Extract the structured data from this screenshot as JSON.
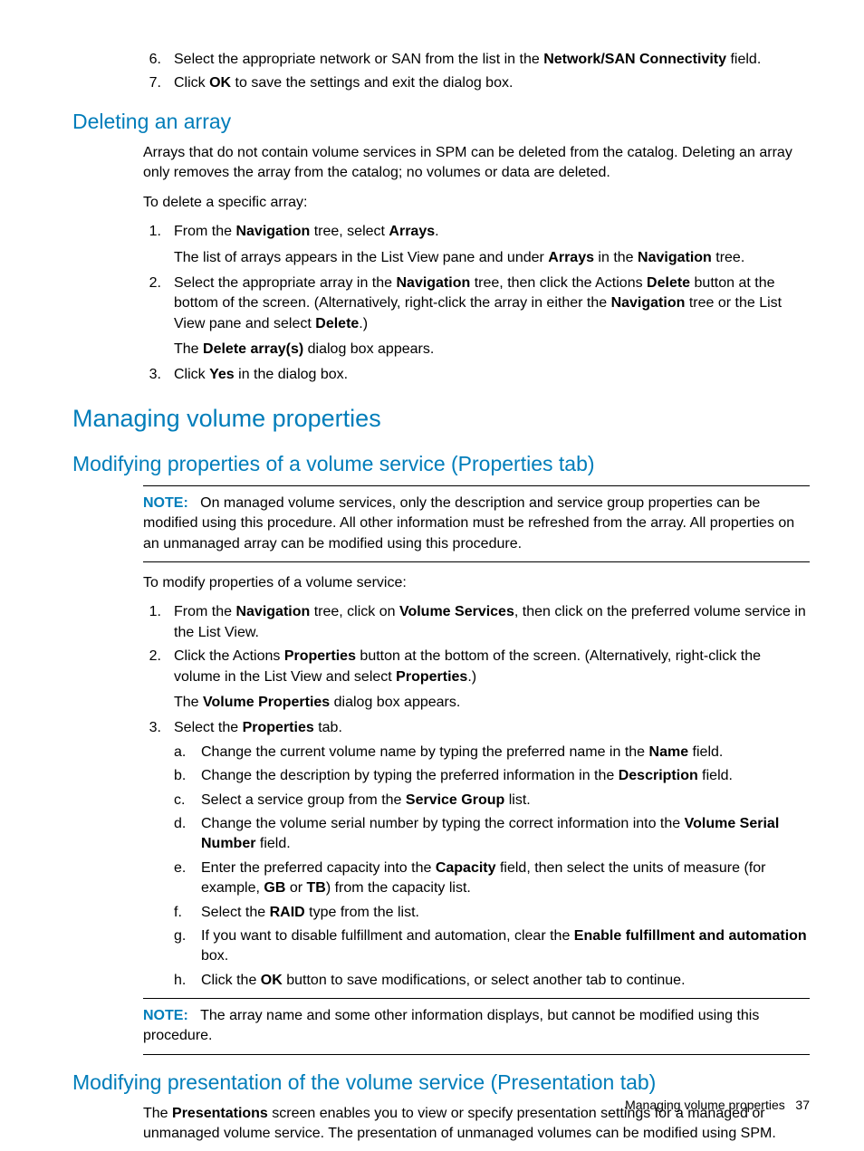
{
  "top_ol": {
    "i6": {
      "n": "6.",
      "pre": "Select the appropriate network or SAN from the list in the ",
      "b": "Network/SAN Connectivity",
      "post": " field."
    },
    "i7": {
      "n": "7.",
      "pre": "Click ",
      "b": "OK",
      "post": " to save the settings and exit the dialog box."
    }
  },
  "s1": {
    "title": "Deleting an array",
    "p1": "Arrays that do not contain volume services in SPM can be deleted from the catalog. Deleting an array only removes the array from the catalog; no volumes or data are deleted.",
    "p2": "To delete a specific array:",
    "i1": {
      "n": "1.",
      "a": "From the ",
      "b1": "Navigation",
      "c": " tree, select ",
      "b2": "Arrays",
      "d": ".",
      "sub_a": "The list of arrays appears in the List View pane and under ",
      "sub_b1": "Arrays",
      "sub_c": " in the ",
      "sub_b2": "Navigation",
      "sub_d": " tree."
    },
    "i2": {
      "n": "2.",
      "a": "Select the appropriate array in the ",
      "b1": "Navigation",
      "c": " tree, then click the Actions ",
      "b2": "Delete",
      "d": " button at the bottom of the screen. (Alternatively, right-click the array in either the ",
      "b3": "Navigation",
      "e": " tree or the List View pane and select ",
      "b4": "Delete",
      "f": ".)",
      "sub_a": "The ",
      "sub_b": "Delete array(s)",
      "sub_c": " dialog box appears."
    },
    "i3": {
      "n": "3.",
      "a": "Click ",
      "b1": "Yes",
      "c": " in the dialog box."
    }
  },
  "major": "Managing volume properties",
  "s2": {
    "title": "Modifying properties of a volume service (Properties tab)",
    "noteLabel": "NOTE:",
    "note1": "On managed volume services, only the description and service group properties can be modified using this procedure. All other information must be refreshed from the array. All properties on an unmanaged array can be modified using this procedure.",
    "p1": "To modify properties of a volume service:",
    "i1": {
      "n": "1.",
      "a": "From the ",
      "b1": "Navigation",
      "c": " tree, click on ",
      "b2": "Volume Services",
      "d": ", then click on the preferred volume service in the List View."
    },
    "i2": {
      "n": "2.",
      "a": "Click the Actions ",
      "b1": "Properties",
      "c": " button at the bottom of the screen. (Alternatively, right-click the volume in the List View and select ",
      "b2": "Properties",
      "d": ".)",
      "sub_a": "The ",
      "sub_b": "Volume Properties",
      "sub_c": " dialog box appears."
    },
    "i3": {
      "n": "3.",
      "a": "Select the ",
      "b1": "Properties",
      "c": " tab."
    },
    "sa": {
      "n": "a.",
      "a": "Change the current volume name by typing the preferred name in the ",
      "b1": "Name",
      "c": " field."
    },
    "sb": {
      "n": "b.",
      "a": "Change the description by typing the preferred information in the ",
      "b1": "Description",
      "c": " field."
    },
    "sc": {
      "n": "c.",
      "a": "Select a service group from the ",
      "b1": "Service Group",
      "c": " list."
    },
    "sd": {
      "n": "d.",
      "a": "Change the volume serial number by typing the correct information into the ",
      "b1": "Volume Serial Number",
      "c": " field."
    },
    "se": {
      "n": "e.",
      "a": "Enter the preferred capacity into the ",
      "b1": "Capacity",
      "c": " field, then select the units of measure (for example, ",
      "b2": "GB",
      "d": " or ",
      "b3": "TB",
      "e": ") from the capacity list."
    },
    "sf": {
      "n": "f.",
      "a": "Select the ",
      "b1": "RAID",
      "c": " type from the list."
    },
    "sg": {
      "n": "g.",
      "a": "If you want to disable fulfillment and automation, clear the ",
      "b1": "Enable fulfillment and automation",
      "c": " box."
    },
    "sh": {
      "n": "h.",
      "a": "Click the ",
      "b1": "OK",
      "c": " button to save modifications, or select another tab to continue."
    },
    "note2": "The array name and some other information displays, but cannot be modified using this procedure."
  },
  "s3": {
    "title": "Modifying presentation of the volume service (Presentation tab)",
    "p1a": "The ",
    "p1b": "Presentations",
    "p1c": " screen enables you to view or specify presentation settings for a managed or unmanaged volume service. The presentation of unmanaged volumes can be modified using SPM."
  },
  "footer": {
    "label": "Managing volume properties",
    "page": "37"
  }
}
